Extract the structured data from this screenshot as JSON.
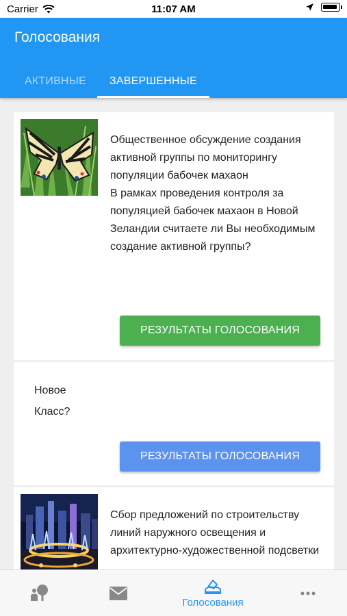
{
  "status_bar": {
    "carrier": "Carrier",
    "time": "11:07 AM"
  },
  "header": {
    "title": "Голосования",
    "tabs": [
      {
        "label": "АКТИВНЫЕ",
        "active": false
      },
      {
        "label": "ЗАВЕРШЕННЫЕ",
        "active": true
      }
    ]
  },
  "polls": [
    {
      "title": "Общественное обсуждение создания активной группы по мониторингу популяции бабочек махаон",
      "question": "В рамках проведения контроля за популяцией бабочек махаон в Новой Зеландии считаете ли Вы необходимым создание активной группы?",
      "button_label": "РЕЗУЛЬТАТЫ ГОЛОСОВАНИЯ",
      "button_color": "#4caf50"
    },
    {
      "title": "Новое",
      "question": "Класс?",
      "button_label": "РЕЗУЛЬТАТЫ ГОЛОСОВАНИЯ",
      "button_color": "#5c93ee"
    },
    {
      "title": "Сбор предложений по строительству линий наружного освещения и архитектурно-художественной подсветки"
    }
  ],
  "bottom_nav": [
    {
      "icon": "person-tree-icon",
      "label": ""
    },
    {
      "icon": "mail-icon",
      "label": ""
    },
    {
      "icon": "vote-box-icon",
      "label": "Голосования",
      "active": true
    },
    {
      "icon": "more-icon",
      "label": ""
    }
  ],
  "colors": {
    "primary": "#2196f3",
    "green": "#4caf50",
    "blue_button": "#5c93ee"
  }
}
